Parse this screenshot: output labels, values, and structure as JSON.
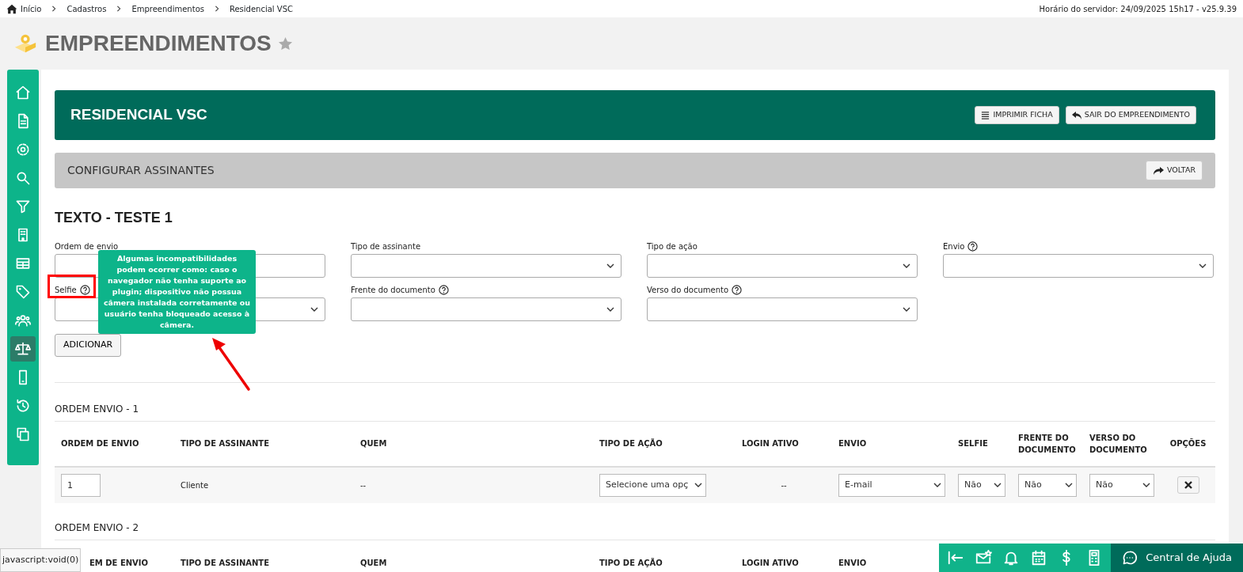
{
  "breadcrumb": [
    {
      "label": "Início"
    },
    {
      "label": "Cadastros"
    },
    {
      "label": "Empreendimentos"
    },
    {
      "label": "Residencial VSC"
    }
  ],
  "server_time": "Horário do servidor: 24/09/2025 15h17 - v25.9.39",
  "page_title": "EMPREENDIMENTOS",
  "favorite": false,
  "sidebar": [
    {
      "selected": false
    },
    {
      "selected": false
    },
    {
      "selected": false
    },
    {
      "selected": false
    },
    {
      "selected": false
    },
    {
      "selected": false
    },
    {
      "selected": false
    },
    {
      "selected": false
    },
    {
      "selected": false
    },
    {
      "selected": true
    },
    {
      "selected": false
    },
    {
      "selected": false
    },
    {
      "selected": false
    }
  ],
  "header": {
    "title": "RESIDENCIAL VSC",
    "buttons": [
      "IMPRIMIR FICHA",
      "SAIR DO EMPREENDIMENTO"
    ]
  },
  "section": {
    "title": "CONFIGURAR ASSINANTES",
    "button": "VOLTAR"
  },
  "form": {
    "title": "TEXTO - TESTE 1",
    "button": "ADICIONAR",
    "fields": [
      {
        "label": "Ordem de envio",
        "kind": "text",
        "help": false
      },
      {
        "label": "Tipo de assinante",
        "kind": "select",
        "help": false
      },
      {
        "label": "Tipo de ação",
        "kind": "select",
        "help": false
      },
      {
        "label": "Envio",
        "kind": "select",
        "help": true
      },
      {
        "label": "Selfie",
        "kind": "select",
        "help": true
      },
      {
        "label": "Frente do documento",
        "kind": "select",
        "help": true
      },
      {
        "label": "Verso do documento",
        "kind": "select",
        "help": true
      }
    ]
  },
  "tooltip": "Algumas incompatibilidades podem ocorrer como: caso o navegador não tenha suporte ao plugin; dispositivo não possua câmera instalada corretamente ou usuário tenha bloqueado acesso à câmera.",
  "groups": [
    {
      "title": "ORDEM ENVIO - 1",
      "columns": [
        "ORDEM DE ENVIO",
        "TIPO DE ASSINANTE",
        "QUEM",
        "TIPO DE AÇÃO",
        "LOGIN ATIVO",
        "ENVIO",
        "SELFIE",
        "FRENTE DO DOCUMENTO",
        "VERSO DO DOCUMENTO",
        "OPÇÕES"
      ],
      "rows": [
        [
          {
            "kind": "input",
            "value": "1"
          },
          {
            "kind": "text",
            "value": "Cliente"
          },
          {
            "kind": "text",
            "value": "--"
          },
          {
            "kind": "select",
            "value": "Selecione uma opç"
          },
          {
            "kind": "center",
            "value": "--"
          },
          {
            "kind": "select",
            "value": "E-mail"
          },
          {
            "kind": "select",
            "value": "Não"
          },
          {
            "kind": "select",
            "value": "Não"
          },
          {
            "kind": "select",
            "value": "Não"
          },
          {
            "kind": "remove"
          }
        ]
      ]
    },
    {
      "title": "ORDEM ENVIO - 2",
      "columns": [
        "EM DE ENVIO",
        "TIPO DE ASSINANTE",
        "QUEM",
        "TIPO DE AÇÃO",
        "LOGIN ATIVO",
        "ENVIO"
      ]
    }
  ],
  "status_link": "javascript:void(0)",
  "help_center": "Central de Ajuda"
}
